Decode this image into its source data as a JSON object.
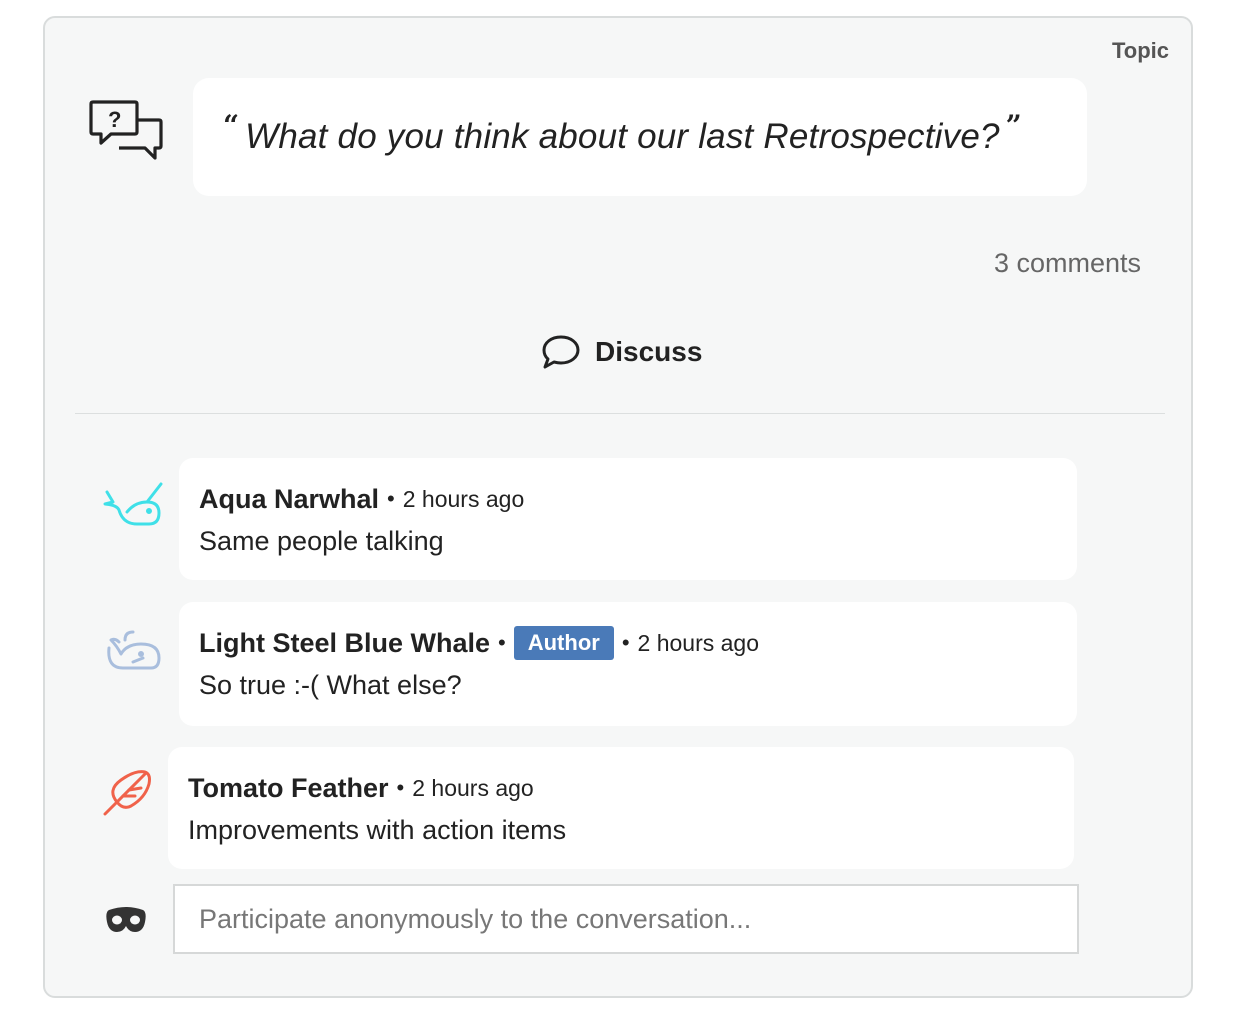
{
  "topic": {
    "label": "Topic",
    "open_quote": "“",
    "question": "What do you think about our last Retrospective?",
    "close_quote": "”",
    "icon": "question-chat-bubbles-icon"
  },
  "comments_count": "3 comments",
  "discuss": {
    "label": "Discuss",
    "icon": "speech-bubble-icon"
  },
  "comments": [
    {
      "author": "Aqua Narwhal",
      "separator": "•",
      "time": "2 hours ago",
      "text": "Same people talking",
      "avatar": "narwhal-icon",
      "avatar_color": "#3fe0e8"
    },
    {
      "author": "Light Steel Blue Whale",
      "separator": "•",
      "badge": "Author",
      "time": "2 hours ago",
      "text": "So true :-( What else?",
      "avatar": "whale-icon",
      "avatar_color": "#a9bedd",
      "badge_color": "#4a7ab8"
    },
    {
      "author": "Tomato Feather",
      "separator": "•",
      "time": "2 hours ago",
      "text": "Improvements with action items",
      "avatar": "feather-icon",
      "avatar_color": "#f0624a"
    }
  ],
  "anonymous": {
    "placeholder": "Participate anonymously to the conversation...",
    "icon": "mask-icon"
  }
}
